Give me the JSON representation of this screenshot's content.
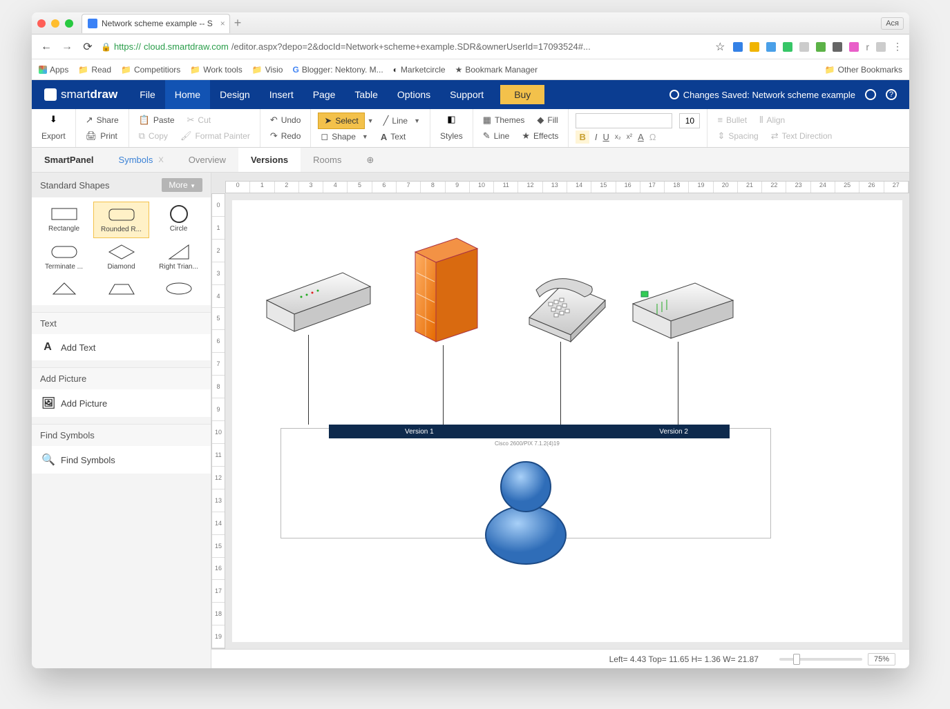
{
  "browser": {
    "tab_title": "Network scheme example -- S",
    "user_badge": "Ася",
    "url_proto": "https://",
    "url_host": "cloud.smartdraw.com",
    "url_path": "/editor.aspx?depo=2&docId=Network+scheme+example.SDR&ownerUserId=17093524#...",
    "bookmarks": [
      "Apps",
      "Read",
      "Competitiors",
      "Work tools",
      "Visio",
      "Blogger: Nektony. M...",
      "Marketcircle",
      "Bookmark Manager"
    ],
    "other_bookmarks": "Other Bookmarks"
  },
  "app": {
    "brand": "smartdraw",
    "menu": [
      "File",
      "Home",
      "Design",
      "Insert",
      "Page",
      "Table",
      "Options",
      "Support"
    ],
    "menu_active": "Home",
    "buy": "Buy",
    "status": "Changes Saved: Network scheme example"
  },
  "ribbon": {
    "export": "Export",
    "share": "Share",
    "print": "Print",
    "paste": "Paste",
    "cut": "Cut",
    "copy": "Copy",
    "format_painter": "Format Painter",
    "undo": "Undo",
    "redo": "Redo",
    "select": "Select",
    "shape": "Shape",
    "line": "Line",
    "text": "Text",
    "styles": "Styles",
    "themes": "Themes",
    "line2": "Line",
    "fill": "Fill",
    "effects": "Effects",
    "font_size": "10",
    "bullet": "Bullet",
    "spacing": "Spacing",
    "align": "Align",
    "text_dir": "Text Direction"
  },
  "paneltabs": {
    "smartpanel": "SmartPanel",
    "symbols": "Symbols",
    "overview": "Overview",
    "versions": "Versions",
    "rooms": "Rooms"
  },
  "sidebar": {
    "shapes_header": "Standard Shapes",
    "more": "More",
    "shapes": [
      "Rectangle",
      "Rounded R...",
      "Circle",
      "Terminate ...",
      "Diamond",
      "Right Trian...",
      "",
      "",
      ""
    ],
    "text_h": "Text",
    "add_text": "Add Text",
    "picture_h": "Add Picture",
    "add_picture": "Add Picture",
    "find_h": "Find Symbols",
    "find_symbols": "Find Symbols"
  },
  "canvas": {
    "version1": "Version 1",
    "version2": "Version 2",
    "cisco": "Cisco 2600/PIX 7.1.2(4)19"
  },
  "statusbar": {
    "coords": "Left= 4.43 Top= 11.65 H= 1.36 W= 21.87",
    "zoom": "75%"
  }
}
